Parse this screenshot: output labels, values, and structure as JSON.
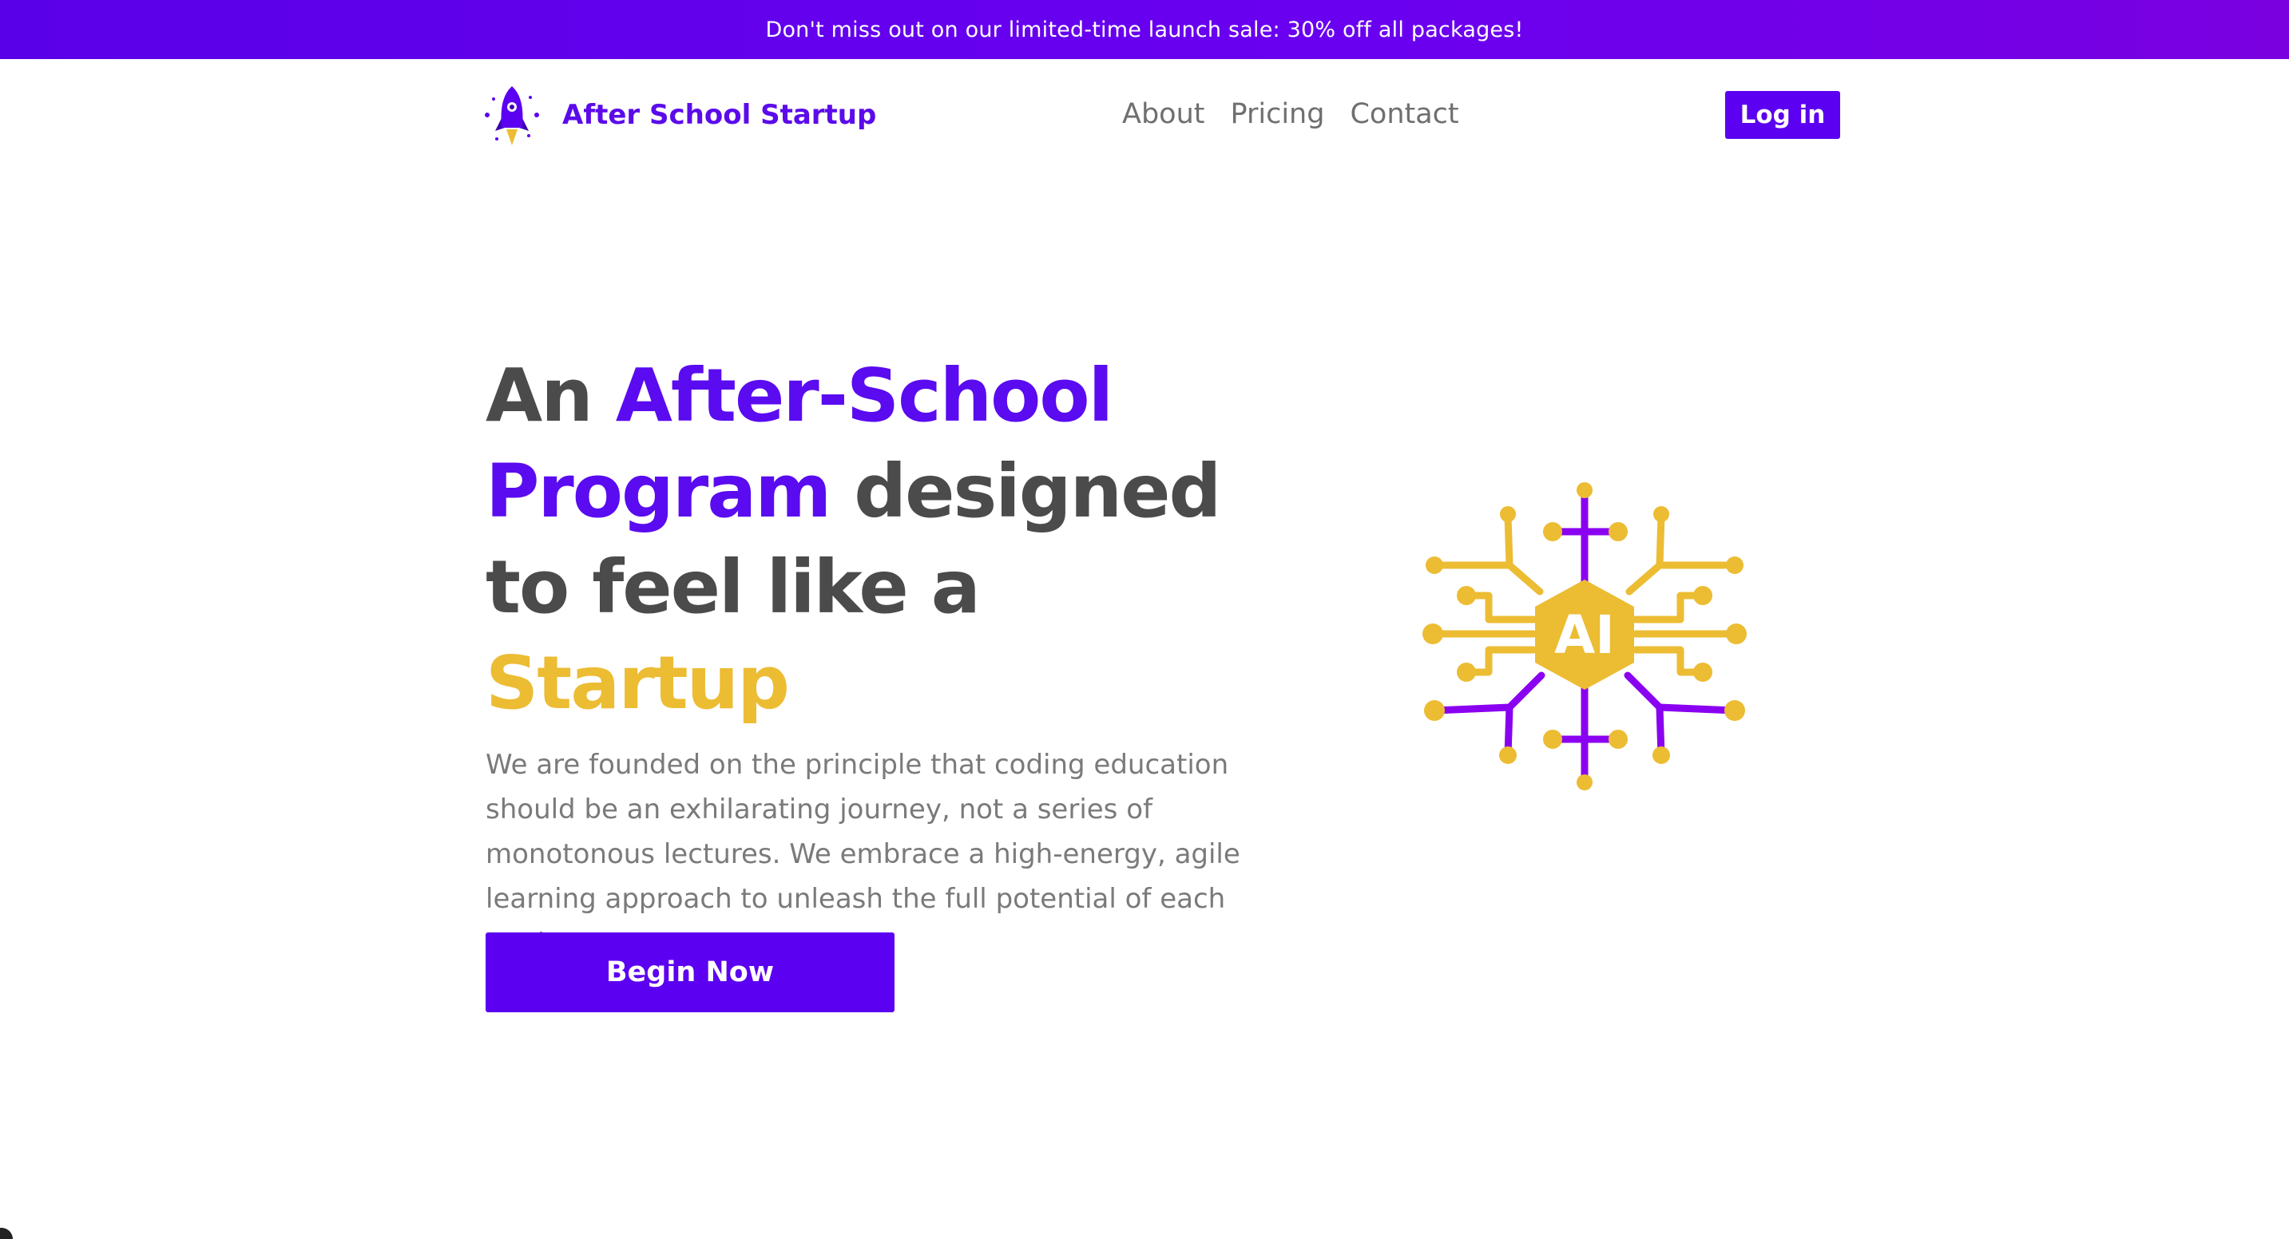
{
  "banner": {
    "text": "Don't miss out on our limited-time launch sale: 30% off all packages!"
  },
  "nav": {
    "brand": "After School Startup",
    "logo_icon": "rocket-icon",
    "links": [
      "About",
      "Pricing",
      "Contact"
    ],
    "login_label": "Log in"
  },
  "hero": {
    "title_part1": "An ",
    "title_part2": "After-School",
    "title_part3": "Program",
    "title_part4": " designed",
    "title_part5": "to feel like a ",
    "title_part6": "Startup",
    "description": "We are founded on the principle that coding education should be an exhilarating journey, not a series of monotonous lectures. We embrace a high-energy, agile learning approach to unleash the full potential of each student.",
    "cta_label": "Begin Now"
  },
  "illustration": {
    "icon": "ai-circuit-icon",
    "label": "AI"
  },
  "colors": {
    "primary": "#5b00f0",
    "accent": "#ecbc33",
    "text_dark": "#4b4b4b",
    "text_muted": "#7a7a7a"
  }
}
